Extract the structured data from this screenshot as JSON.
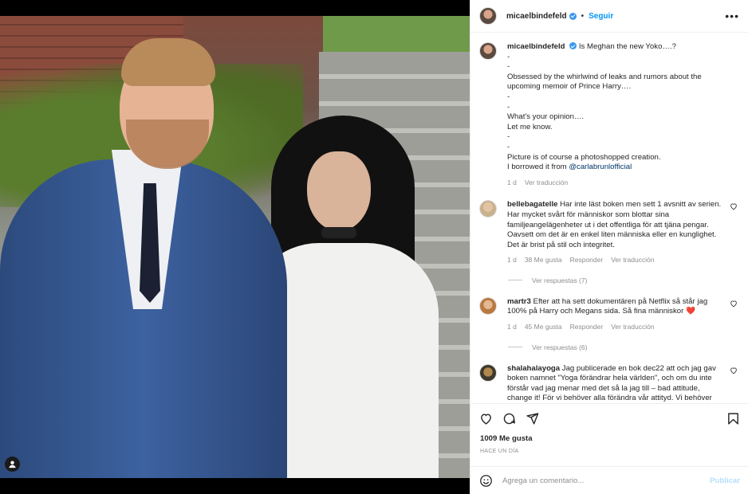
{
  "post": {
    "author": "micaelbindefeld",
    "follow_label": "Seguir",
    "dot": "•",
    "more_label": "•••",
    "caption_lines": [
      "Is Meghan the new Yoko….?",
      "-",
      "-",
      "Obsessed by the whirlwind of leaks and rumors about the",
      "upcoming memoir of Prince Harry….",
      "-",
      "-",
      "What's your opinion….",
      "Let me know.",
      "-",
      "-",
      "Picture is of course a photoshopped creation.",
      "I borrowed it from "
    ],
    "caption_mention": "@carlabrunlofficial",
    "caption_time": "1 d",
    "see_translation": "Ver traducción"
  },
  "comments": [
    {
      "user": "bellebagatelle",
      "lines": [
        "Har inte läst boken men sett 1 avsnitt av serien.",
        "Har mycket svårt för människor som blottar sina",
        "familjeangelägenheter ut i det offentliga för att tjäna pengar.",
        "Oavsett om det är en enkel liten människa eller en kunglighet.",
        "Det är brist på stil och integritet."
      ],
      "time": "1 d",
      "likes": "38 Me gusta",
      "reply": "Responder",
      "translate": "Ver traducción",
      "view_replies": "Ver respuestas (7)"
    },
    {
      "user": "martr3",
      "lines": [
        "Efter att ha sett dokumentären på Netflix så står jag",
        "100% på Harry och Megans sida. Så fina människor"
      ],
      "emoji": "❤️",
      "time": "1 d",
      "likes": "45 Me gusta",
      "reply": "Responder",
      "translate": "Ver traducción",
      "view_replies": "Ver respuestas (6)"
    },
    {
      "user": "shalahalayoga",
      "lines": [
        "Jag publicerade en bok dec22 att och jag gav",
        "boken namnet \"Yoga förändrar hela världen\", och om du inte",
        "förstår vad jag menar med det så la jag till – bad attitude,",
        "change it! För vi behöver alla förändra vår attityd. Vi behöver"
      ]
    }
  ],
  "footer": {
    "likes": "1009 Me gusta",
    "time_ago": "HACE UN DÍA",
    "comment_placeholder": "Agrega un comentario...",
    "publish_label": "Publicar"
  },
  "colors": {
    "accent": "#0095f6",
    "verified": "#3897f0",
    "muted": "#8e8e8e",
    "text": "#262626",
    "heart": "#ed4956"
  },
  "icons": [
    "verified-icon",
    "more-options-icon",
    "heart-icon",
    "comment-icon",
    "share-icon",
    "save-icon",
    "emoji-icon",
    "user-tag-icon"
  ]
}
